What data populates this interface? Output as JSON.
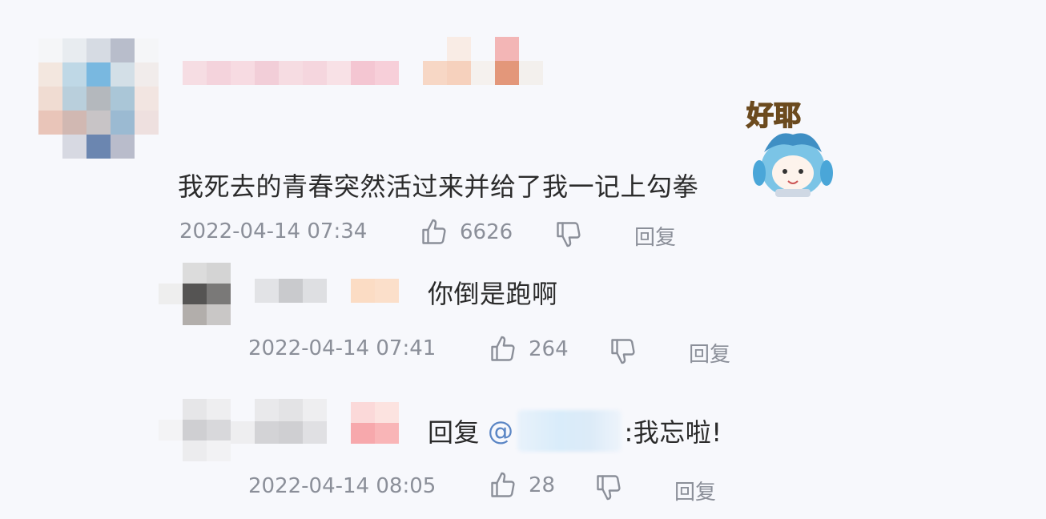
{
  "comment": {
    "text": "我死去的青春突然活过来并给了我一记上勾拳",
    "time": "2022-04-14 07:34",
    "likes": "6626",
    "reply_label": "回复",
    "sticker_text": "好耶"
  },
  "replies": [
    {
      "text": "你倒是跑啊",
      "time": "2022-04-14 07:41",
      "likes": "264",
      "reply_label": "回复"
    },
    {
      "prefix": "回复",
      "at": "@",
      "text": ":我忘啦!",
      "time": "2022-04-14 08:05",
      "likes": "28",
      "reply_label": "回复"
    }
  ],
  "icons": {
    "like": "thumbs-up-icon",
    "dislike": "thumbs-down-icon"
  },
  "colors": {
    "background": "#f7f8fc",
    "meta_text": "#8b8f99",
    "main_text": "#2b2b2b",
    "mention": "#5b86c5"
  }
}
